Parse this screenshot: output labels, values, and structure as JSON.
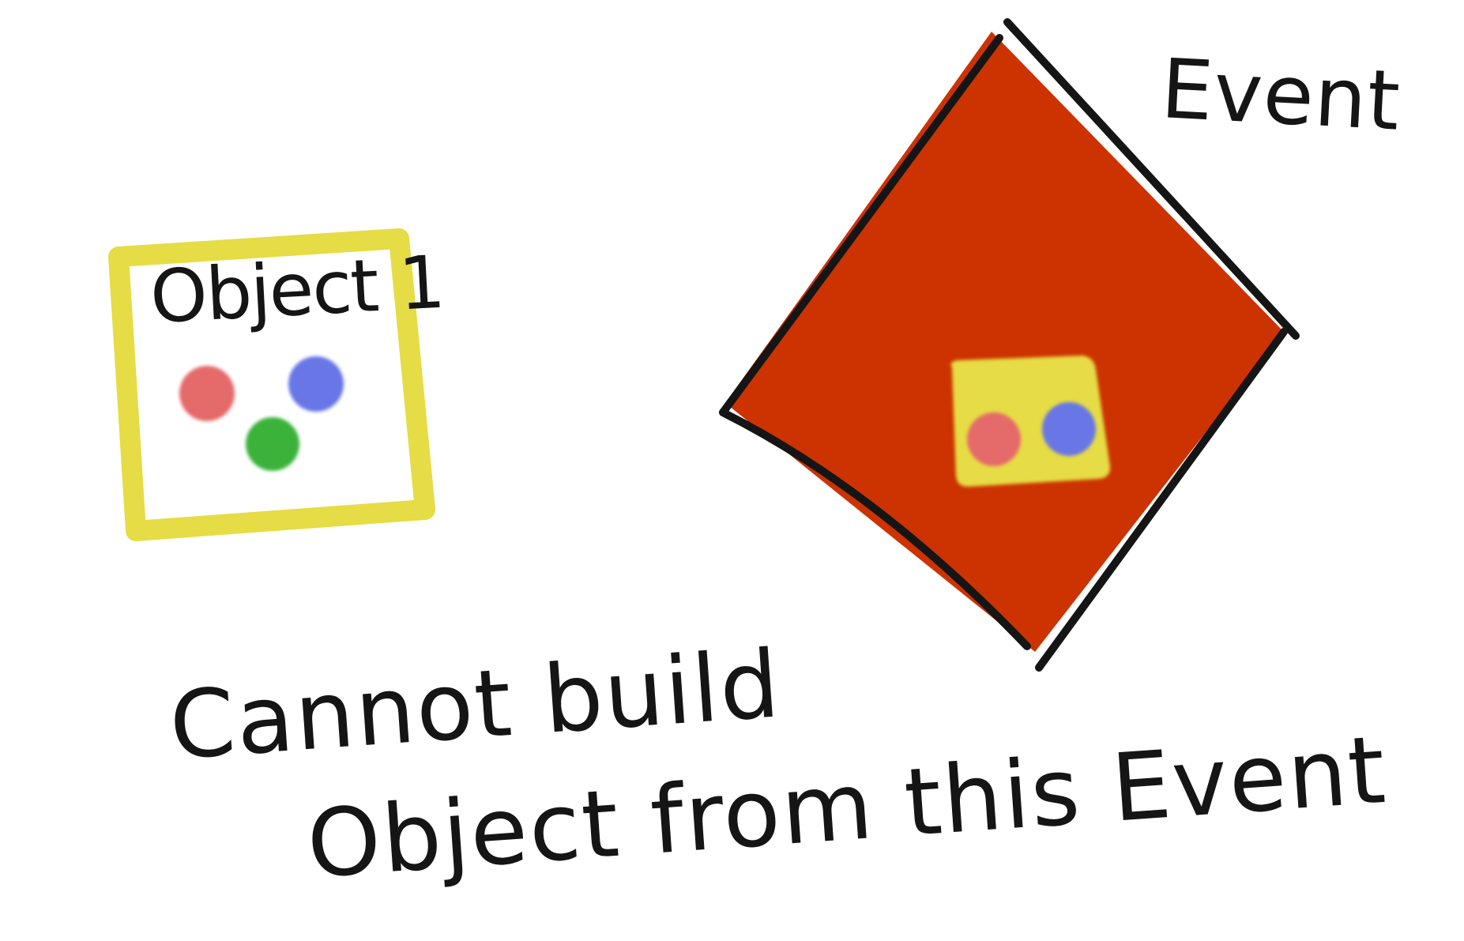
{
  "labels": {
    "object": "Object 1",
    "event": "Event"
  },
  "caption": {
    "line1": "Cannot build",
    "line2": "Object from this Event"
  },
  "colors": {
    "object_frame": "#e6dc45",
    "event_fill": "#cc3300",
    "ink": "#151515",
    "dot_red": "#e56a6a",
    "dot_blue": "#6876e6",
    "dot_green": "#3ab33a",
    "inner_box": "#e6dc45"
  },
  "object1_dots": [
    "red",
    "blue",
    "green"
  ],
  "event_inner_dots": [
    "red",
    "blue"
  ]
}
